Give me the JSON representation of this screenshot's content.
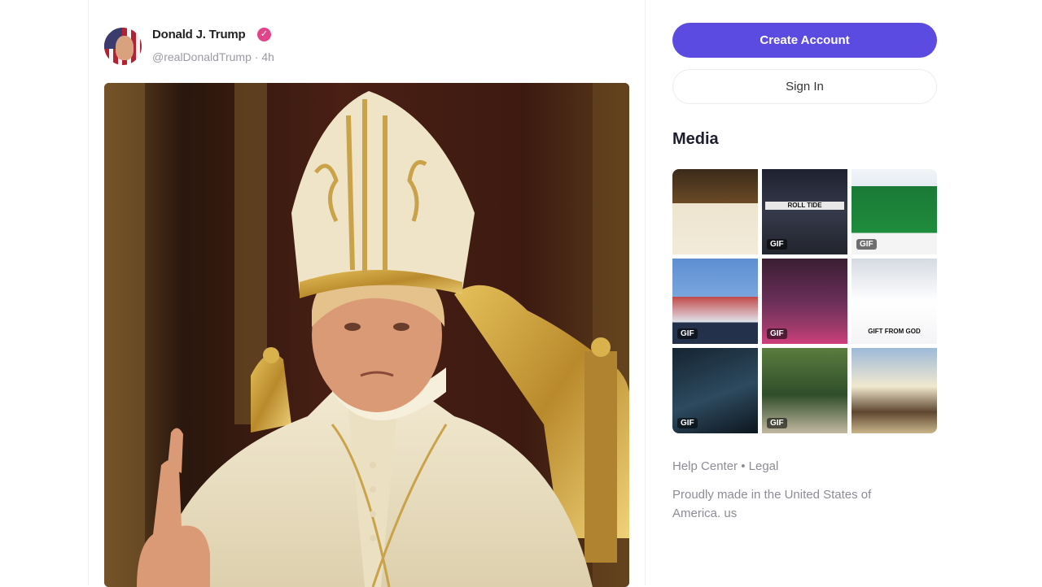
{
  "post": {
    "author_name": "Donald J. Trump",
    "handle": "@realDonaldTrump",
    "separator": "·",
    "time_ago": "4h",
    "verified_icon": "verified-badge-icon"
  },
  "sidebar": {
    "create_account_label": "Create Account",
    "sign_in_label": "Sign In",
    "media_title": "Media",
    "media": [
      {
        "gif": ""
      },
      {
        "gif": "GIF",
        "text": "ROLL TIDE"
      },
      {
        "gif": "GIF"
      },
      {
        "gif": "GIF"
      },
      {
        "gif": "GIF"
      },
      {
        "gif": "",
        "text": "GIFT FROM GOD"
      },
      {
        "gif": "GIF"
      },
      {
        "gif": "GIF"
      },
      {
        "gif": ""
      }
    ],
    "footer": {
      "help_center": "Help Center",
      "bullet": "•",
      "legal": "Legal",
      "made_in": "Proudly made in the United States of America. us"
    }
  },
  "colors": {
    "accent": "#5b4be0",
    "verified": "#e0458a",
    "muted_text": "#8c8c95"
  }
}
